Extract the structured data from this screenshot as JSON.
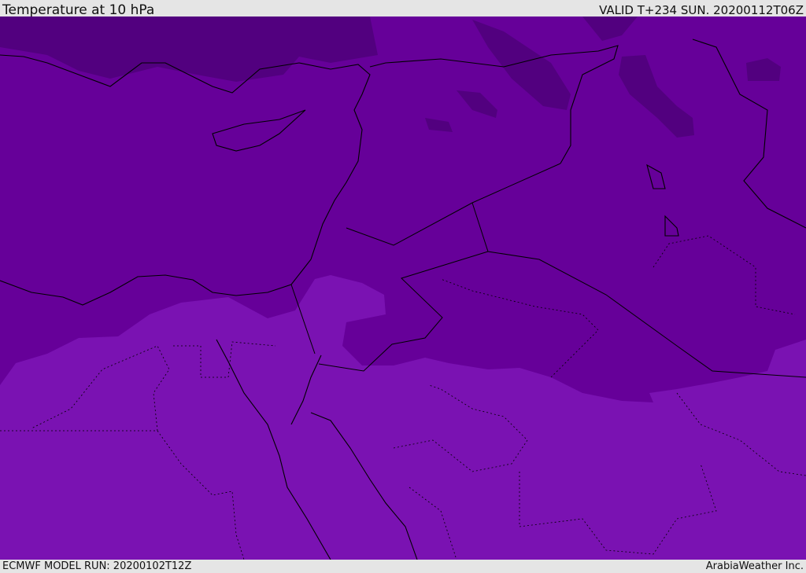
{
  "header": {
    "title": "Temperature at 10 hPa",
    "valid": "VALID T+234 SUN. 20200112T06Z"
  },
  "footer": {
    "model_run": "ECMWF MODEL RUN: 20200102T12Z",
    "brand": "ArabiaWeather Inc."
  },
  "colors": {
    "dark": "#52007f",
    "mid": "#660099",
    "light": "#7a12b2",
    "border": "#000000",
    "background": "#e5e5e5"
  }
}
